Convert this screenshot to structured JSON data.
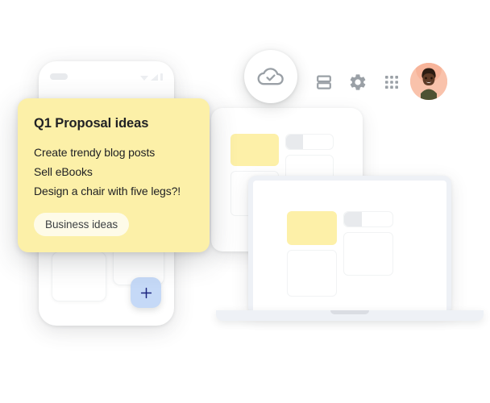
{
  "scene": {
    "description": "Cross-device note-taking illustration",
    "accent_yellow": "#fcf0a8",
    "note_yellow": "#fdf0a8",
    "chip_cream": "#fefbe8",
    "fab_blue": "#c5d9f7",
    "fab_plus_color": "#1a237e",
    "device_gray": "#eef1f6",
    "icon_gray": "#9aa0a6",
    "text_primary": "#202124",
    "avatar_bg": "#f8bda6"
  },
  "note": {
    "title": "Q1 Proposal ideas",
    "lines": [
      "Create trendy blog posts",
      "Sell eBooks",
      "Design a chair with five legs?!"
    ],
    "chip_label": "Business ideas"
  },
  "phone": {
    "status_bar": {
      "speaker": "speaker-pill",
      "icons": [
        "signal-triangle-icon",
        "wifi-icon",
        "battery-icon"
      ]
    },
    "fab": {
      "icon": "plus-icon",
      "label": "+"
    },
    "cards": [
      "note-card-a",
      "note-card-b"
    ]
  },
  "toolbar": {
    "items": [
      {
        "name": "cloud-done-badge",
        "icon": "cloud-check-icon",
        "label": "Synced to cloud"
      },
      {
        "name": "layout-toggle",
        "icon": "list-view-icon",
        "label": "List view"
      },
      {
        "name": "settings",
        "icon": "gear-icon",
        "label": "Settings"
      },
      {
        "name": "apps-launcher",
        "icon": "grid-apps-icon",
        "label": "Apps"
      },
      {
        "name": "account",
        "icon": "avatar-icon",
        "label": "Account"
      }
    ]
  },
  "tablet": {
    "cards": [
      {
        "type": "note",
        "color": "#fdf0a8"
      },
      {
        "type": "split",
        "color": "#ffffff"
      },
      {
        "type": "plain",
        "color": "#ffffff"
      },
      {
        "type": "plain",
        "color": "#ffffff"
      }
    ]
  },
  "laptop": {
    "cards": [
      {
        "type": "note",
        "color": "#fdf0a8"
      },
      {
        "type": "split",
        "color": "#ffffff"
      },
      {
        "type": "plain",
        "color": "#ffffff"
      },
      {
        "type": "plain",
        "color": "#ffffff"
      }
    ]
  }
}
